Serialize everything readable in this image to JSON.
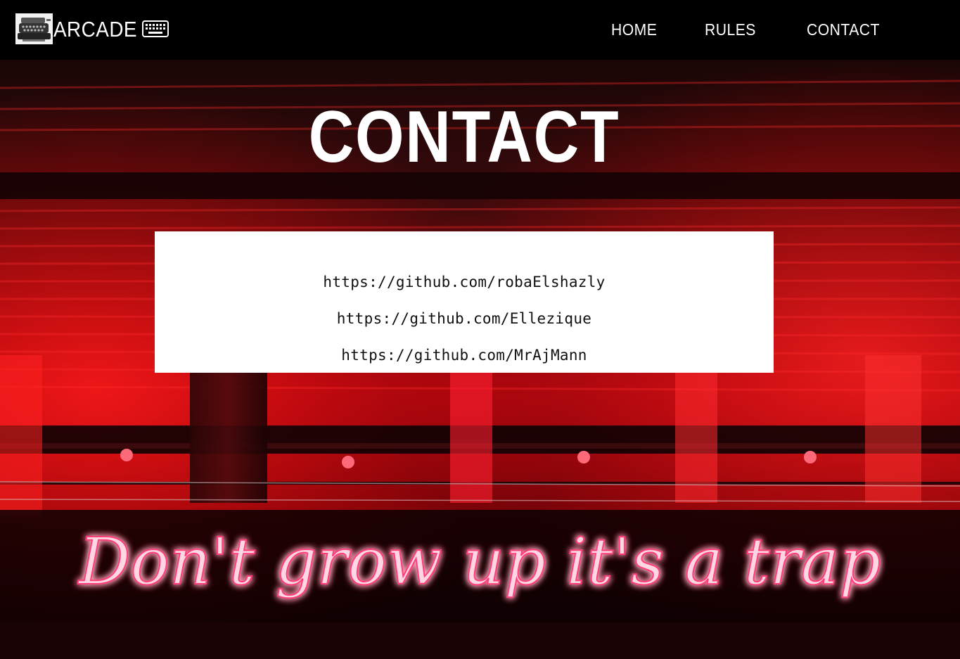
{
  "nav": {
    "brand": "ARCADE",
    "logo_icon": "typewriter-icon",
    "keyboard_icon": "keyboard-icon",
    "links": [
      {
        "label": "HOME"
      },
      {
        "label": "RULES"
      },
      {
        "label": "CONTACT"
      }
    ]
  },
  "page": {
    "title": "CONTACT"
  },
  "contacts": [
    {
      "url": "https://github.com/robaElshazly"
    },
    {
      "url": "https://github.com/Ellezique"
    },
    {
      "url": "https://github.com/MrAjMann"
    }
  ],
  "hero": {
    "neon_text": "Don't grow up it's a trap"
  },
  "colors": {
    "nav_bg": "#000000",
    "neon_pink": "#ff3c78",
    "neon_red": "#e0101c",
    "card_bg": "#ffffff"
  }
}
